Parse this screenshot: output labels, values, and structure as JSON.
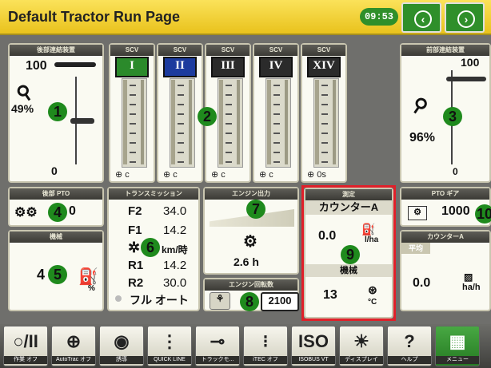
{
  "header": {
    "title": "Default Tractor Run Page",
    "clock": "09:53"
  },
  "hitch_rear": {
    "header": "後部連結装置",
    "top_value": "100",
    "percent": "49%",
    "bottom_value": "0",
    "callout": "1"
  },
  "scv": [
    {
      "header": "SCV",
      "label": "I",
      "footer": "c",
      "color": "#2b8a2b"
    },
    {
      "header": "SCV",
      "label": "II",
      "footer": "c",
      "color": "#1c3b9e"
    },
    {
      "header": "SCV",
      "label": "III",
      "footer": "c",
      "color": "#2b2b2b"
    },
    {
      "header": "SCV",
      "label": "IV",
      "footer": "c",
      "color": "#2b2b2b"
    },
    {
      "header": "SCV",
      "label": "XIV",
      "footer": "0s",
      "color": "#2b2b2b"
    }
  ],
  "scv_callout": "2",
  "hitch_front": {
    "header": "前部連結装置",
    "top_value": "100",
    "percent": "96%",
    "bottom_value": "0",
    "callout": "3"
  },
  "pto_rear": {
    "header": "後部 PTO",
    "value": "0",
    "callout": "4"
  },
  "implement": {
    "header": "機械",
    "value": "4",
    "unit": "%",
    "callout": "5"
  },
  "transmission": {
    "header": "トランスミッション",
    "rows": [
      {
        "gear": "F2",
        "speed": "34.0"
      },
      {
        "gear": "F1",
        "speed": "14.2"
      },
      {
        "gear": "R1",
        "speed": "14.2"
      },
      {
        "gear": "R2",
        "speed": "30.0"
      }
    ],
    "unit": "km/時",
    "mode": "フル オート",
    "callout": "6"
  },
  "engine_output": {
    "header": "エンジン出力",
    "hours": "2.6 h",
    "callout": "7"
  },
  "engine_rpm": {
    "header": "エンジン回転数",
    "value": "2100",
    "callout": "8"
  },
  "measure": {
    "header": "測定",
    "counter": "カウンターA",
    "rate": "0.0",
    "rate_unit": "l/ha",
    "sub_header": "機械",
    "temp": "13",
    "temp_unit": "°C",
    "callout": "9"
  },
  "pto_gear": {
    "header": "PTO ギア",
    "value": "1000",
    "callout": "10"
  },
  "counter_a": {
    "header": "カウンターA",
    "avg_label": "平均",
    "value": "0.0",
    "unit": "ha/h"
  },
  "bottom_bar": [
    {
      "icon": "○/II",
      "label": "作業  オフ"
    },
    {
      "icon": "⊕",
      "label": "AutoTrac  オフ"
    },
    {
      "icon": "◉",
      "label": "誘導"
    },
    {
      "icon": "⋮",
      "label": "QUICK LINE"
    },
    {
      "icon": "⊸",
      "label": "トラックモ..."
    },
    {
      "icon": "⁝",
      "label": "iTEC  オフ"
    },
    {
      "icon": "ISO",
      "label": "ISOBUS VT"
    },
    {
      "icon": "☀",
      "label": "ディスプレイ"
    },
    {
      "icon": "?",
      "label": "ヘルプ"
    },
    {
      "icon": "▦",
      "label": "メニュー"
    }
  ],
  "colors": {
    "accent": "#2f8f2a",
    "header_yellow": "#f2d23a",
    "highlight": "#e0202a"
  }
}
